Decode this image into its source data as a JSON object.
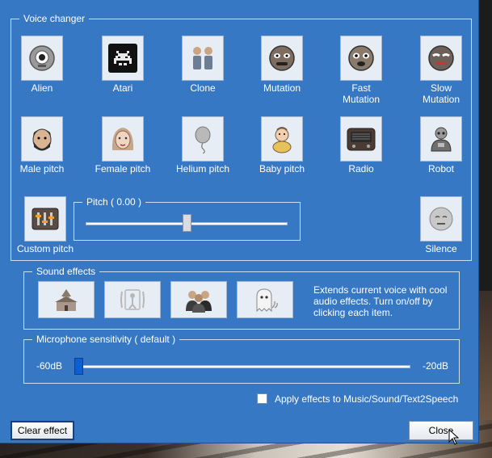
{
  "voice_changer": {
    "group_title": "Voice changer",
    "effects_row1": [
      {
        "label": "Alien",
        "icon": "alien-icon"
      },
      {
        "label": "Atari",
        "icon": "atari-icon"
      },
      {
        "label": "Clone",
        "icon": "clone-icon"
      },
      {
        "label": "Mutation",
        "icon": "mutation-icon"
      },
      {
        "label": "Fast\nMutation",
        "icon": "fast-mutation-icon"
      },
      {
        "label": "Slow\nMutation",
        "icon": "slow-mutation-icon"
      }
    ],
    "effects_row2": [
      {
        "label": "Male pitch",
        "icon": "male-face-icon"
      },
      {
        "label": "Female pitch",
        "icon": "female-face-icon"
      },
      {
        "label": "Helium pitch",
        "icon": "balloon-icon"
      },
      {
        "label": "Baby pitch",
        "icon": "baby-icon"
      },
      {
        "label": "Radio",
        "icon": "radio-icon"
      },
      {
        "label": "Robot",
        "icon": "robot-icon"
      }
    ],
    "custom_pitch_label": "Custom pitch",
    "silence_label": "Silence",
    "pitch": {
      "title": "Pitch ( 0.00 )",
      "value": 0.0,
      "min": -1.0,
      "max": 1.0
    }
  },
  "sound_effects": {
    "group_title": "Sound effects",
    "items": [
      {
        "icon": "church-icon"
      },
      {
        "icon": "echo-figure-icon"
      },
      {
        "icon": "crowd-icon"
      },
      {
        "icon": "ghost-icon"
      }
    ],
    "description": "Extends current voice with cool audio effects. Turn on/off by clicking each item."
  },
  "microphone": {
    "group_title": "Microphone sensitivity ( default )",
    "min_label": "-60dB",
    "max_label": "-20dB",
    "level": 0.0
  },
  "apply_effects_label": "Apply effects to Music/Sound/Text2Speech",
  "apply_effects_checked": false,
  "buttons": {
    "clear": "Clear effect",
    "close": "Close"
  },
  "colors": {
    "dialog_bg": "#3778c4",
    "tile_bg": "#e7edf4",
    "accent_thumb": "#0a5fd6"
  }
}
